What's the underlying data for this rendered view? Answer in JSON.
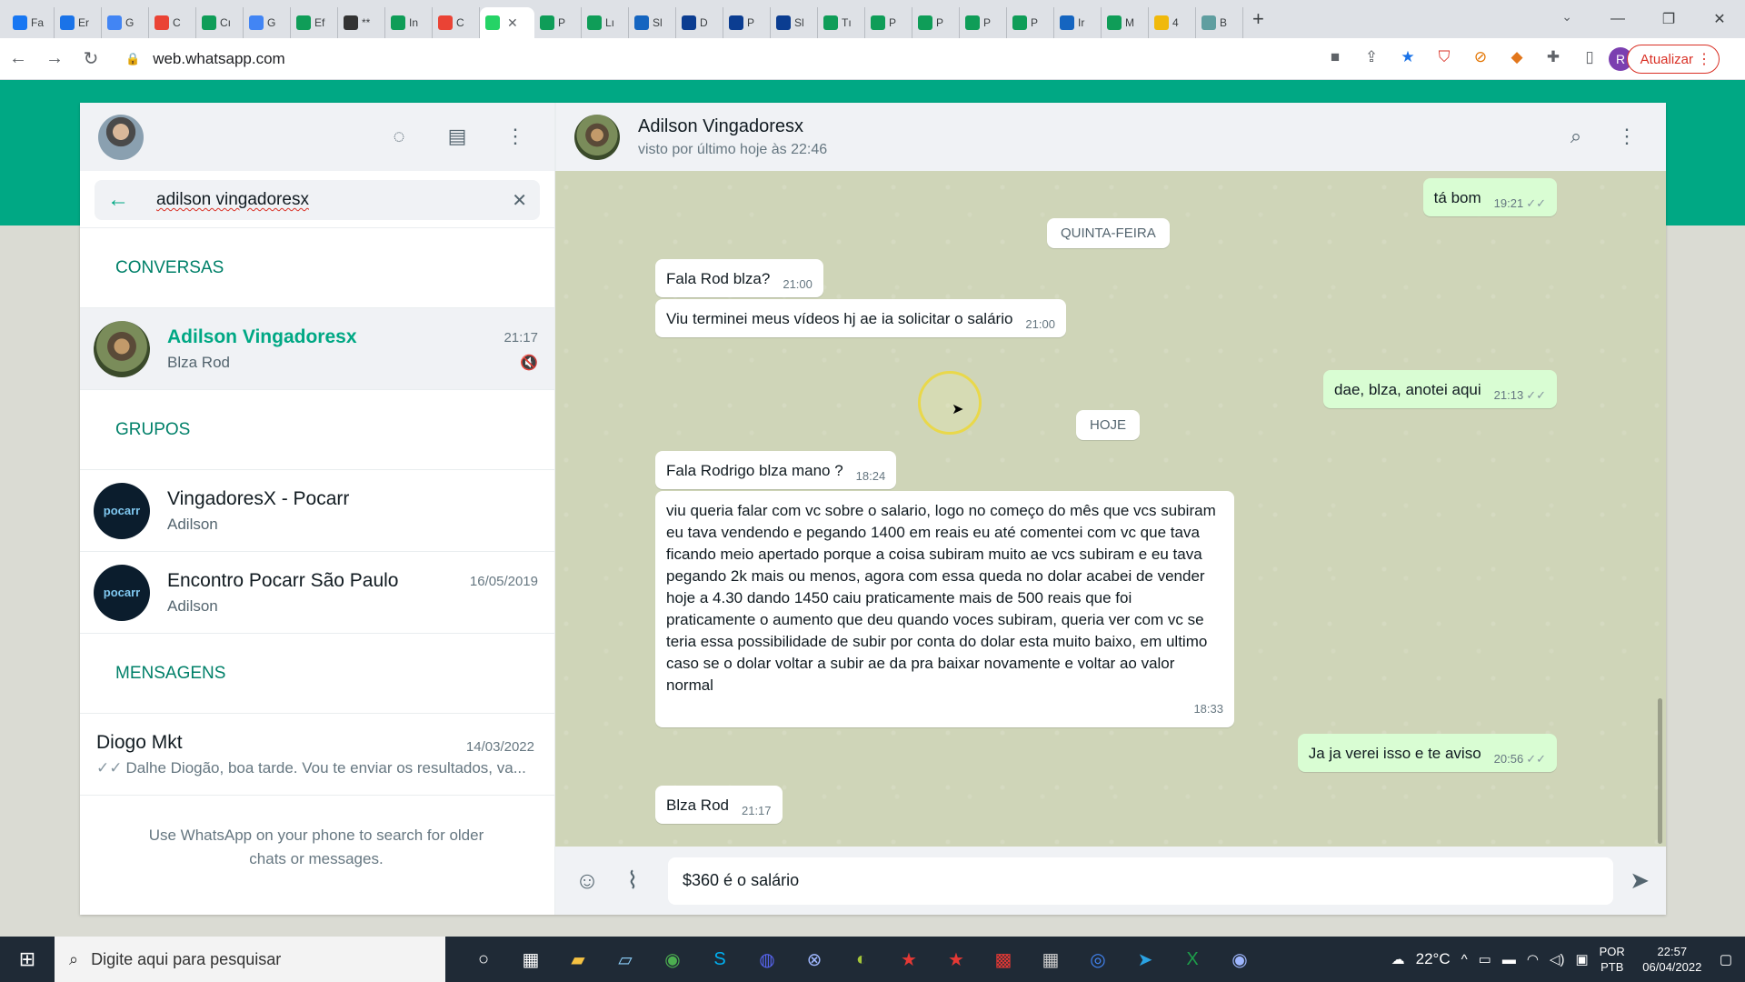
{
  "browser": {
    "tabs": [
      {
        "label": "Fa",
        "color": "#1877f2"
      },
      {
        "label": "Er",
        "color": "#1a73e8"
      },
      {
        "label": "G",
        "color": "#4285f4"
      },
      {
        "label": "C",
        "color": "#ea4335"
      },
      {
        "label": "Cı",
        "color": "#0f9d58"
      },
      {
        "label": "G",
        "color": "#4285f4"
      },
      {
        "label": "Ef",
        "color": "#0f9d58"
      },
      {
        "label": "**",
        "color": "#333333"
      },
      {
        "label": "In",
        "color": "#0f9d58"
      },
      {
        "label": "C",
        "color": "#ea4335"
      },
      {
        "label": "",
        "color": "#25d366",
        "active": true
      },
      {
        "label": "P",
        "color": "#0f9d58"
      },
      {
        "label": "Lı",
        "color": "#0f9d58"
      },
      {
        "label": "Sl",
        "color": "#1565c0"
      },
      {
        "label": "D",
        "color": "#0b3d91"
      },
      {
        "label": "P",
        "color": "#0b3d91"
      },
      {
        "label": "Sl",
        "color": "#0b3d91"
      },
      {
        "label": "Tı",
        "color": "#0f9d58"
      },
      {
        "label": "P",
        "color": "#0f9d58"
      },
      {
        "label": "P",
        "color": "#0f9d58"
      },
      {
        "label": "P",
        "color": "#0f9d58"
      },
      {
        "label": "P",
        "color": "#0f9d58"
      },
      {
        "label": "Ir",
        "color": "#1565c0"
      },
      {
        "label": "M",
        "color": "#0f9d58"
      },
      {
        "label": "4",
        "color": "#f0b90b"
      },
      {
        "label": "B",
        "color": "#5f9ea0"
      }
    ],
    "url": "web.whatsapp.com",
    "update_label": "Atualizar",
    "profile_initial": "R"
  },
  "sidebar": {
    "search_value": "adilson vingadoresx",
    "section_conversas": "CONVERSAS",
    "section_grupos": "GRUPOS",
    "section_mensagens": "MENSAGENS",
    "conversas": [
      {
        "name": "Adilson Vingadoresx",
        "sub": "Blza Rod",
        "time": "21:17"
      }
    ],
    "grupos": [
      {
        "name": "VingadoresX - Pocarr",
        "sub": "Adilson",
        "time": "",
        "avatar_text": "pocarr"
      },
      {
        "name": "Encontro Pocarr São Paulo",
        "sub": "Adilson",
        "time": "16/05/2019",
        "avatar_text": "pocarr"
      }
    ],
    "mensagens": [
      {
        "name": "Diogo Mkt",
        "date": "14/03/2022",
        "preview": "Dalhe Diogão, boa tarde. Vou te enviar os resultados, va..."
      }
    ],
    "hint": "Use WhatsApp on your phone to search for older chats or messages."
  },
  "conversation": {
    "contact_name": "Adilson Vingadoresx",
    "status": "visto por último hoje às 22:46",
    "day_quinta": "QUINTA-FEIRA",
    "day_hoje": "HOJE",
    "messages": [
      {
        "text": "tá bom",
        "time": "19:21"
      },
      {
        "text": "Fala Rod blza?",
        "time": "21:00"
      },
      {
        "text": "Viu terminei meus vídeos hj ae ia solicitar o salário",
        "time": "21:00"
      },
      {
        "text": "dae, blza, anotei aqui",
        "time": "21:13"
      },
      {
        "text": "Fala Rodrigo blza mano ?",
        "time": "18:24"
      },
      {
        "text": "viu queria falar com vc sobre o salario, logo no começo do mês que vcs subiram eu tava vendendo e pegando 1400 em reais eu até comentei com vc que tava ficando meio apertado porque a coisa subiram muito ae vcs subiram e eu tava pegando 2k mais ou menos, agora com essa queda no dolar acabei de vender hoje a 4.30 dando 1450 caiu praticamente mais de 500 reais que foi praticamente o aumento que deu quando voces subiram, queria ver com vc se teria essa possibilidade de subir por conta do dolar esta muito baixo, em ultimo caso se o dolar voltar a subir ae da pra baixar novamente e voltar ao valor normal",
        "time": "18:33"
      },
      {
        "text": "Ja ja verei isso e te aviso",
        "time": "20:56"
      },
      {
        "text": "Blza Rod",
        "time": "21:17"
      }
    ],
    "composer_value": "$360 é o salário"
  },
  "taskbar": {
    "search_placeholder": "Digite aqui para pesquisar",
    "temperature": "22°C",
    "lang_top": "POR",
    "lang_bottom": "PTB",
    "time": "22:57",
    "date": "06/04/2022"
  },
  "colors": {
    "accent": "#00a884",
    "outgoing_bubble": "#d9fdd3",
    "chat_wallpaper": "#cfd5b8"
  }
}
